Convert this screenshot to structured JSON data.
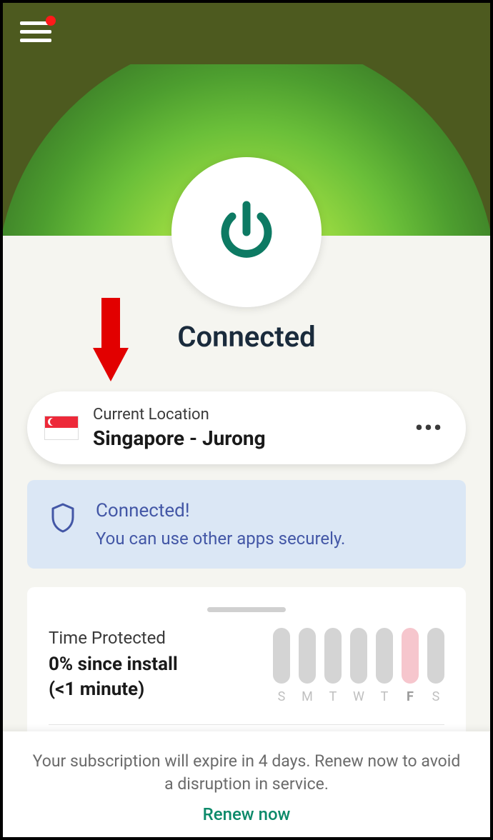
{
  "status": "Connected",
  "location": {
    "label": "Current Location",
    "value": "Singapore - Jurong",
    "flag": "singapore"
  },
  "info": {
    "title": "Connected!",
    "subtitle": "You can use other apps securely."
  },
  "stats": {
    "label": "Time Protected",
    "value_line1": "0% since install",
    "value_line2": "(<1 minute)",
    "days": [
      "S",
      "M",
      "T",
      "W",
      "T",
      "F",
      "S"
    ],
    "active_index": 5
  },
  "footer": {
    "message": "Your subscription will expire in 4 days. Renew now to avoid a disruption in service.",
    "link": "Renew now"
  }
}
